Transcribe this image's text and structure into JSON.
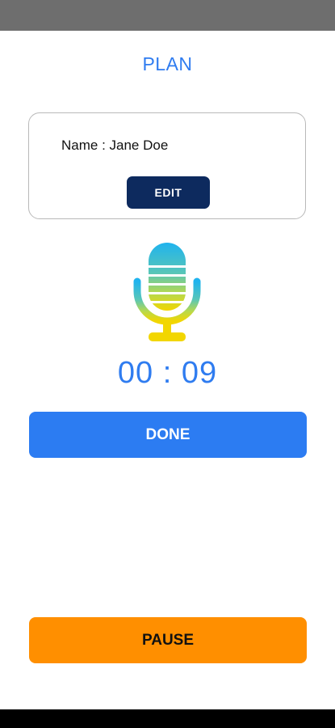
{
  "header": {
    "title": "PLAN"
  },
  "profile_card": {
    "name_text": "Name : Jane Doe",
    "edit_label": "EDIT"
  },
  "recorder": {
    "icon": "microphone-icon",
    "timer": "00 : 09"
  },
  "actions": {
    "done_label": "DONE",
    "pause_label": "PAUSE"
  },
  "colors": {
    "accent_blue": "#2c7cf2",
    "edit_navy": "#0d2a5e",
    "pause_orange": "#ff8f00",
    "mic_gradient_top": "#1fb3ee",
    "mic_gradient_bottom": "#f2d600"
  }
}
